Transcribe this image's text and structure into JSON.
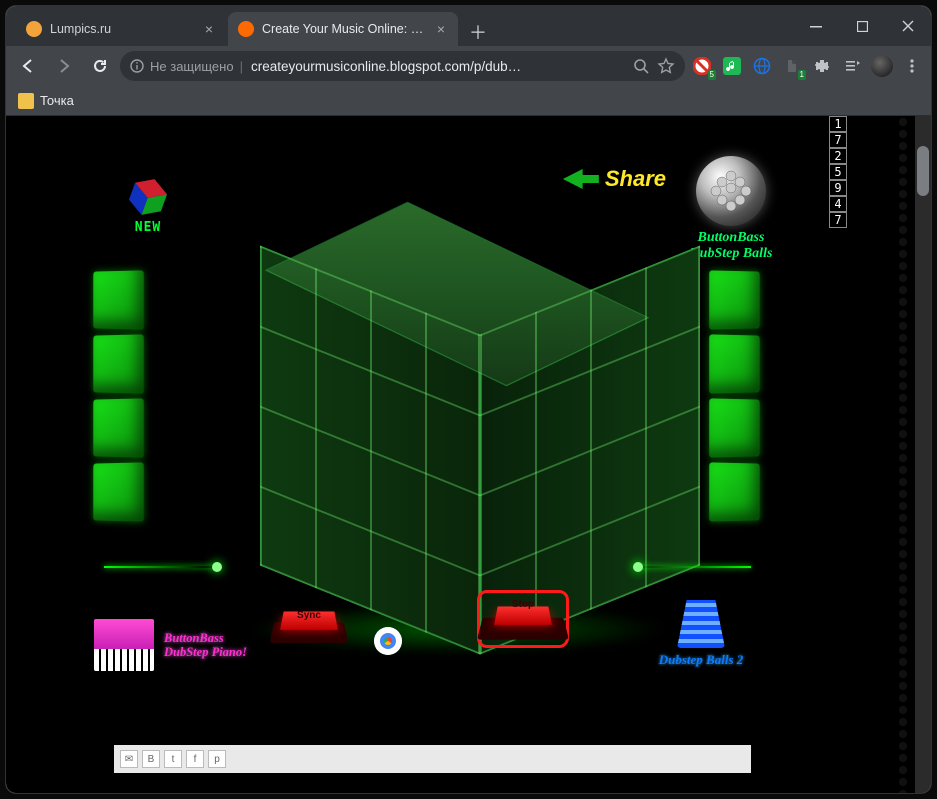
{
  "browser": {
    "tabs": [
      {
        "title": "Lumpics.ru",
        "favicon_color": "#f2a33a",
        "active": false
      },
      {
        "title": "Create Your Music Online: Dubst…",
        "favicon_color": "#ff6a00",
        "active": true
      }
    ],
    "insecure_label": "Не защищено",
    "url_display": "createyourmusiconline.blogspot.com/p/dub…",
    "bookmarks": [
      {
        "label": "Точка"
      }
    ],
    "extension_badges": {
      "adblock": "5",
      "downloads": "1"
    }
  },
  "flash": {
    "new_label": "NEW",
    "share_label": "Share",
    "buttonbass_balls": {
      "line1": "ButtonBass",
      "line2": "DubStep Balls"
    },
    "buttonbass_piano": {
      "line1": "ButtonBass",
      "line2": "DubStep Piano!"
    },
    "dubstep_balls2": "Dubstep Balls 2",
    "sync_label": "Sync",
    "stop_label": "Stop",
    "counter_digits": [
      "1",
      "7",
      "2",
      "5",
      "9",
      "4",
      "7"
    ]
  }
}
